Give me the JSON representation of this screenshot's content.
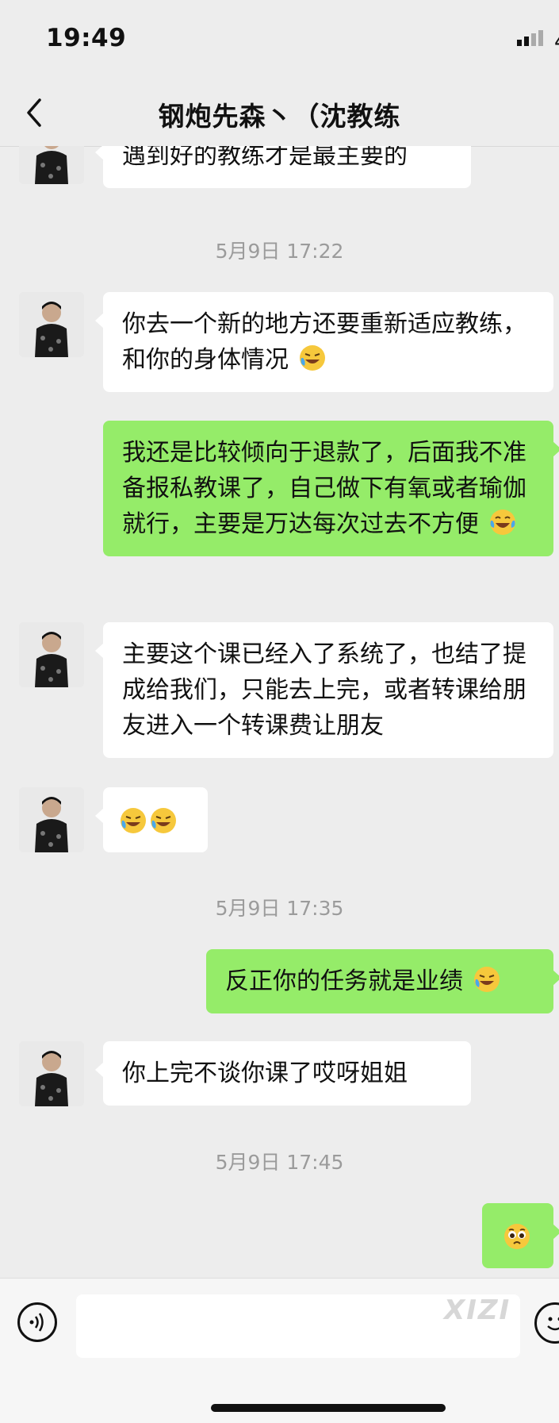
{
  "status_bar": {
    "time": "19:49",
    "battery_partial": "4"
  },
  "header": {
    "title": "钢炮先森丶（沈教练",
    "back_icon": "chevron-left-icon"
  },
  "messages": [
    {
      "side": "in",
      "text": "遇到好的教练才是最主要的"
    },
    {
      "type": "timestamp",
      "text": "5月9日 17:22"
    },
    {
      "side": "in",
      "text": "你去一个新的地方还要重新适应教练，和你的身体情况",
      "emoji": "crying-laughing-emoji"
    },
    {
      "side": "out",
      "text": "我还是比较倾向于退款了，后面我不准备报私教课了，自己做下有氧或者瑜伽就行，主要是万达每次过去不方便",
      "emoji": "tears-of-joy-emoji"
    },
    {
      "side": "in",
      "text": "主要这个课已经入了系统了，也结了提成给我们，只能去上完，或者转课给朋友进入一个转课费让朋友"
    },
    {
      "side": "in",
      "text": "",
      "emoji": "crying-laughing-emoji x2"
    },
    {
      "type": "timestamp",
      "text": "5月9日 17:35"
    },
    {
      "side": "out",
      "text": "反正你的任务就是业绩",
      "emoji": "crying-laughing-emoji"
    },
    {
      "side": "in",
      "text": "你上完不谈你课了哎呀姐姐"
    },
    {
      "type": "timestamp",
      "text": "5月9日 17:45"
    },
    {
      "side": "out",
      "text": "",
      "emoji": "pleading-face-emoji"
    }
  ],
  "input_bar": {
    "voice_icon": "voice-icon",
    "emoji_icon": "emoji-icon",
    "watermark": "XIZI"
  },
  "colors": {
    "outgoing": "#95ec69",
    "incoming": "#ffffff",
    "background": "#ededed"
  }
}
